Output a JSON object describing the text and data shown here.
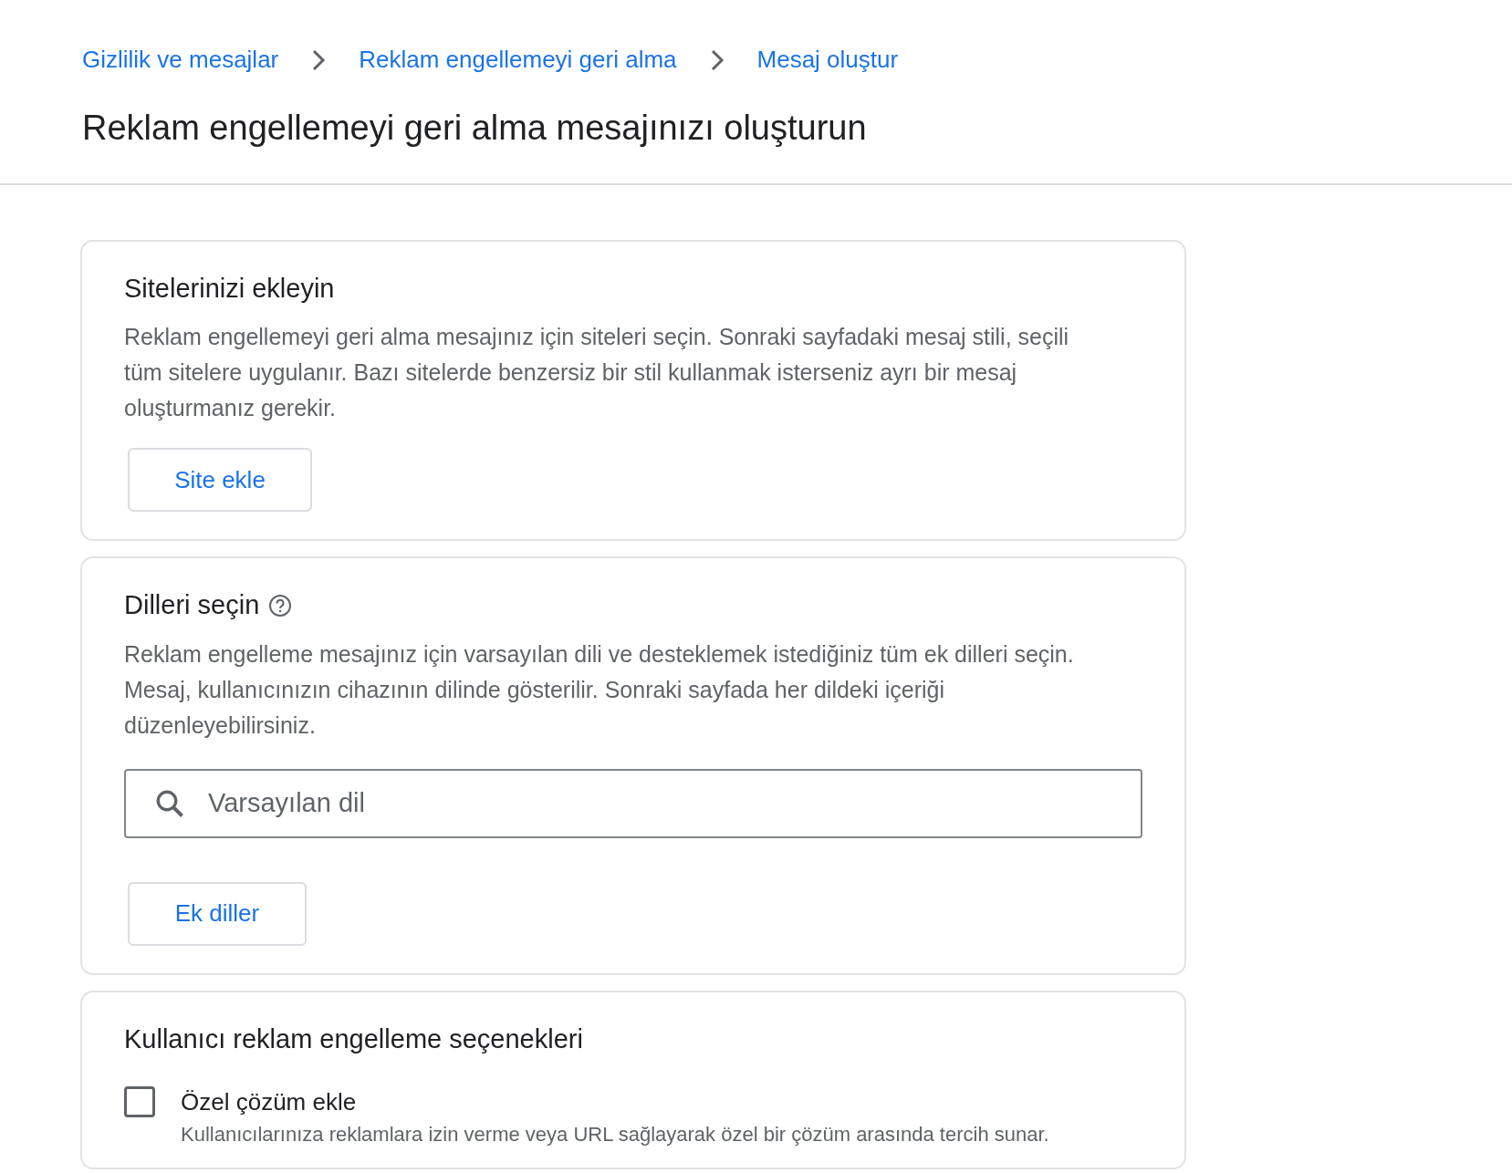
{
  "breadcrumbs": [
    "Gizlilik ve mesajlar",
    "Reklam engellemeyi geri alma",
    "Mesaj oluştur"
  ],
  "title": "Reklam engellemeyi geri alma mesajınızı oluşturun",
  "sites_card": {
    "heading": "Sitelerinizi ekleyin",
    "description": "Reklam engellemeyi geri alma mesajınız için siteleri seçin. Sonraki sayfadaki mesaj stili, seçili tüm sitelere uygulanır. Bazı sitelerde benzersiz bir stil kullanmak isterseniz ayrı bir mesaj oluşturmanız gerekir.",
    "button": "Site ekle"
  },
  "languages_card": {
    "heading": "Dilleri seçin",
    "description": "Reklam engelleme mesajınız için varsayılan dili ve desteklemek istediğiniz tüm ek dilleri seçin. Mesaj, kullanıcınızın cihazının dilinde gösterilir. Sonraki sayfada her dildeki içeriği düzenleyebilirsiniz.",
    "search": {
      "placeholder": "Varsayılan dil"
    },
    "button": "Ek diller"
  },
  "options_card": {
    "heading": "Kullanıcı reklam engelleme seçenekleri",
    "options": [
      {
        "label": "Özel çözüm ekle",
        "description": "Kullanıcılarınıza reklamlara izin verme veya URL sağlayarak özel bir çözüm arasında tercih sunar.",
        "checked": false
      }
    ]
  }
}
